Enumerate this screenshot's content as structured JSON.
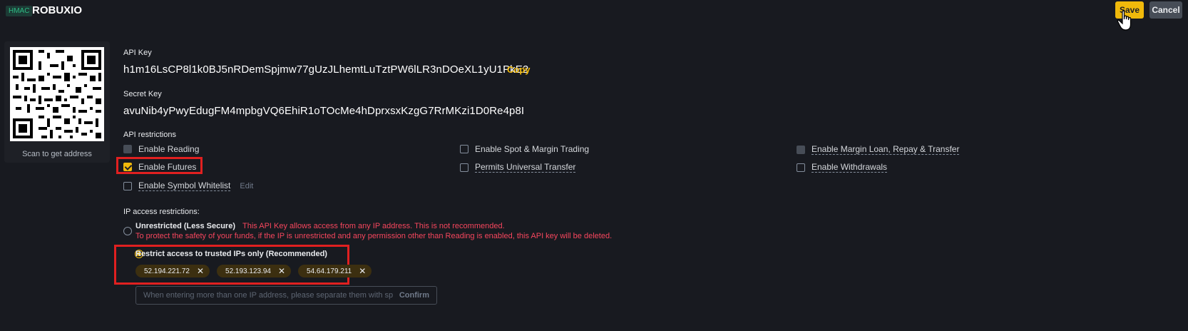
{
  "header": {
    "badge": "HMAC",
    "key_name": "ROBUXIO",
    "save_label": "Save",
    "cancel_label": "Cancel"
  },
  "qr": {
    "caption": "Scan to get address"
  },
  "api_key": {
    "label": "API Key",
    "value": "h1m16LsCP8l1k0BJ5nRDemSpjmw77gUzJLhemtLuTztPW6lLR3nDOeXL1yU1PkE2",
    "copy_label": "Copy"
  },
  "secret_key": {
    "label": "Secret Key",
    "value": "avuNib4yPwyEdugFM4mpbgVQ6EhiR1oTOcMe4hDprxsxKzgG7RrMKzi1D0Re4p8I"
  },
  "restrictions": {
    "title": "API restrictions",
    "enable_reading": "Enable Reading",
    "enable_spot": "Enable Spot & Margin Trading",
    "enable_margin_loan": "Enable Margin Loan, Repay & Transfer",
    "enable_futures": "Enable Futures",
    "permits_universal": "Permits Universal Transfer",
    "enable_withdrawals": "Enable Withdrawals",
    "enable_whitelist": "Enable Symbol Whitelist",
    "edit_label": "Edit"
  },
  "ip": {
    "title": "IP access restrictions:",
    "unrestricted_label": "Unrestricted (Less Secure)",
    "unrestricted_warning": "This API Key allows access from any IP address. This is not recommended.",
    "unrestricted_warning2": "To protect the safety of your funds, if the IP is unrestricted and any permission other than Reading is enabled, this API key will be deleted.",
    "restricted_label": "Restrict access to trusted IPs only (Recommended)",
    "addresses": [
      "52.194.221.72",
      "52.193.123.94",
      "54.64.179.211"
    ],
    "input_placeholder": "When entering more than one IP address, please separate them with spaces.",
    "confirm_label": "Confirm"
  },
  "colors": {
    "accent": "#f0b90b",
    "background": "#181a20",
    "warning": "#f6465d",
    "highlight_box": "#e02020"
  }
}
